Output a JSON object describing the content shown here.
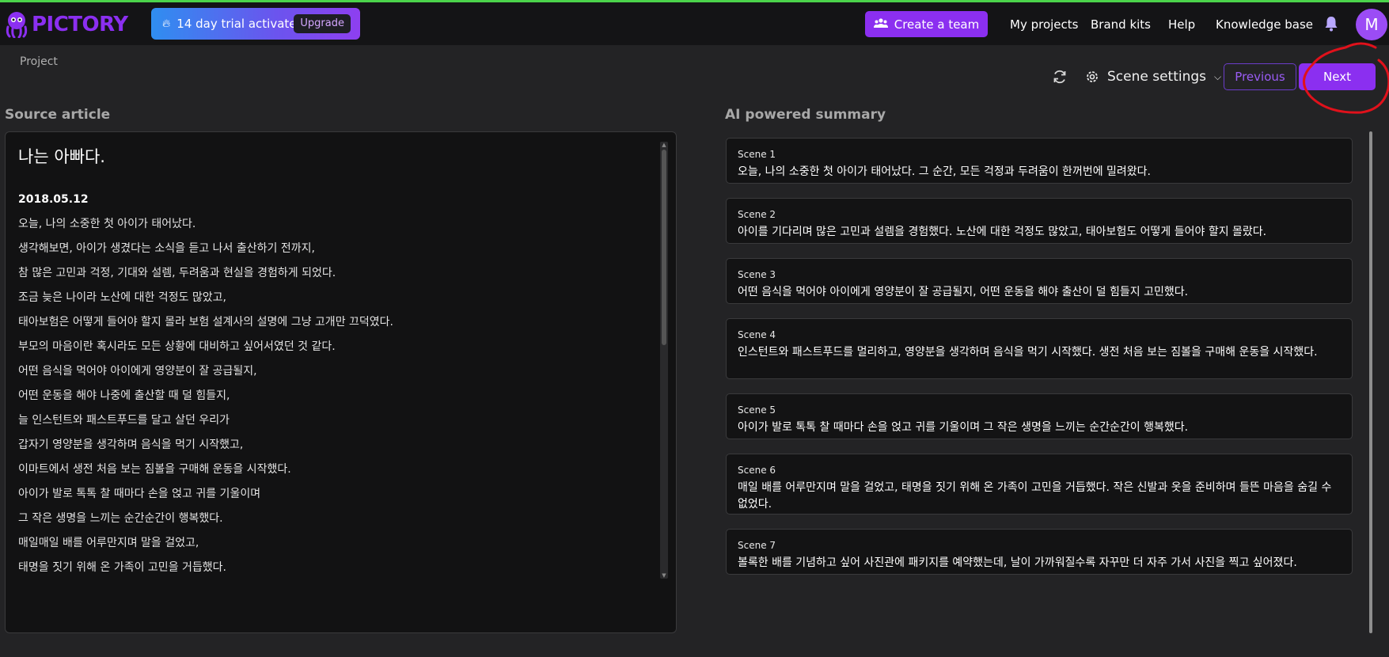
{
  "brand": {
    "name": "PICTORY",
    "color": "#8b2ff0"
  },
  "trial": {
    "icon": "flame-icon",
    "text": "14 day trial activated!",
    "upgrade_label": "Upgrade"
  },
  "nav": {
    "create_team_label": "Create a team",
    "links": [
      "My projects",
      "Brand kits",
      "Help",
      "Knowledge base"
    ],
    "avatar_initial": "M"
  },
  "breadcrumb": "Project",
  "toolbar": {
    "scene_settings_label": "Scene settings",
    "previous_label": "Previous",
    "next_label": "Next"
  },
  "source": {
    "section_title": "Source article",
    "heading": "나는 아빠다.",
    "date": "2018.05.12",
    "lines": [
      "오늘, 나의 소중한 첫 아이가 태어났다.",
      "생각해보면, 아이가 생겼다는 소식을 듣고 나서 출산하기 전까지,",
      "참 많은 고민과 걱정, 기대와 설렘, 두려움과 현실을 경험하게 되었다.",
      "조금 늦은 나이라 노산에 대한 걱정도 많았고,",
      "태아보험은 어떻게 들어야 할지 몰라 보험 설계사의 설명에 그냥 고개만 끄덕였다.",
      "부모의 마음이란 혹시라도 모든 상황에 대비하고 싶어서였던 것 같다.",
      "어떤 음식을 먹어야 아이에게 영양분이 잘 공급될지,",
      "어떤 운동을 해야 나중에 출산할 때 덜 힘들지,",
      "늘 인스턴트와 패스트푸드를 달고 살던 우리가",
      "갑자기 영양분을 생각하며 음식을 먹기 시작했고,",
      "이마트에서 생전 처음 보는 짐볼을 구매해 운동을 시작했다.",
      "아이가 발로 톡톡 찰 때마다 손을 얹고 귀를 기울이며",
      "그 작은 생명을 느끼는 순간순간이 행복했다.",
      "매일매일 배를 어루만지며 말을 걸었고,",
      "태명을 짓기 위해 온 가족이 고민을 거듭했다."
    ]
  },
  "summary": {
    "section_title": "AI powered summary",
    "scenes": [
      {
        "label": "Scene 1",
        "text": "오늘, 나의 소중한 첫 아이가 태어났다. 그 순간, 모든 걱정과 두려움이 한꺼번에 밀려왔다."
      },
      {
        "label": "Scene 2",
        "text": "아이를 기다리며 많은 고민과 설렘을 경험했다. 노산에 대한 걱정도 많았고, 태아보험도 어떻게 들어야 할지 몰랐다."
      },
      {
        "label": "Scene 3",
        "text": "어떤 음식을 먹어야 아이에게 영양분이 잘 공급될지, 어떤 운동을 해야 출산이 덜 힘들지 고민했다."
      },
      {
        "label": "Scene 4",
        "text": "인스턴트와 패스트푸드를 멀리하고, 영양분을 생각하며 음식을 먹기 시작했다. 생전 처음 보는 짐볼을 구매해 운동을 시작했다."
      },
      {
        "label": "Scene 5",
        "text": "아이가 발로 톡톡 찰 때마다 손을 얹고 귀를 기울이며 그 작은 생명을 느끼는 순간순간이 행복했다."
      },
      {
        "label": "Scene 6",
        "text": "매일 배를 어루만지며 말을 걸었고, 태명을 짓기 위해 온 가족이 고민을 거듭했다. 작은 신발과 옷을 준비하며 들뜬 마음을 숨길 수 없었다."
      },
      {
        "label": "Scene 7",
        "text": "볼록한 배를 기념하고 싶어 사진관에 패키지를 예약했는데, 날이 가까워질수록 자꾸만 더 자주 가서 사진을 찍고 싶어졌다."
      }
    ]
  }
}
